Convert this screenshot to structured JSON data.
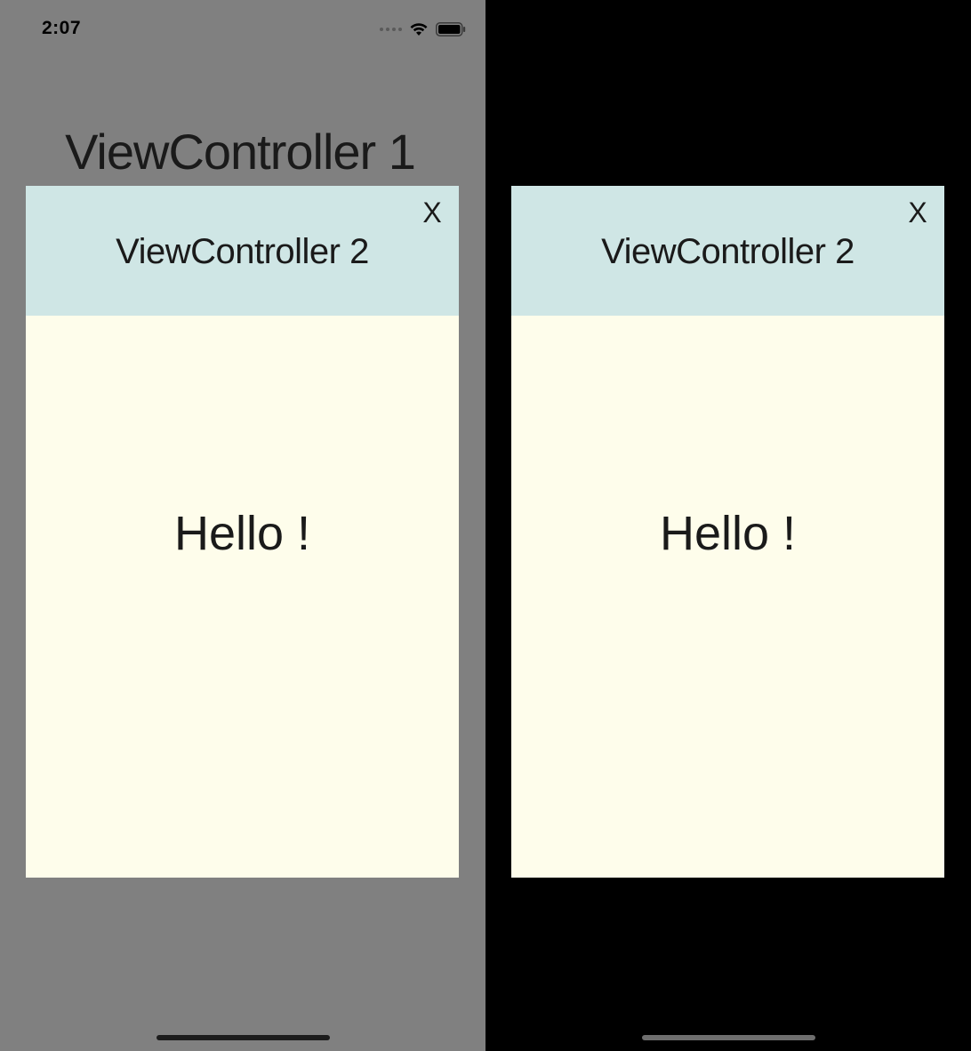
{
  "left_screen": {
    "status_bar": {
      "time": "2:07",
      "icons": [
        "signal-dots-icon",
        "wifi-icon",
        "battery-icon"
      ]
    },
    "background_title": "ViewController 1",
    "modal": {
      "title": "ViewController 2",
      "close_label": "X",
      "body_text": "Hello !"
    }
  },
  "right_screen": {
    "modal": {
      "title": "ViewController 2",
      "close_label": "X",
      "body_text": "Hello !"
    }
  },
  "colors": {
    "left_background": "#808080",
    "right_background": "#000000",
    "modal_header": "#cfe6e5",
    "modal_body": "#fefdeb"
  }
}
